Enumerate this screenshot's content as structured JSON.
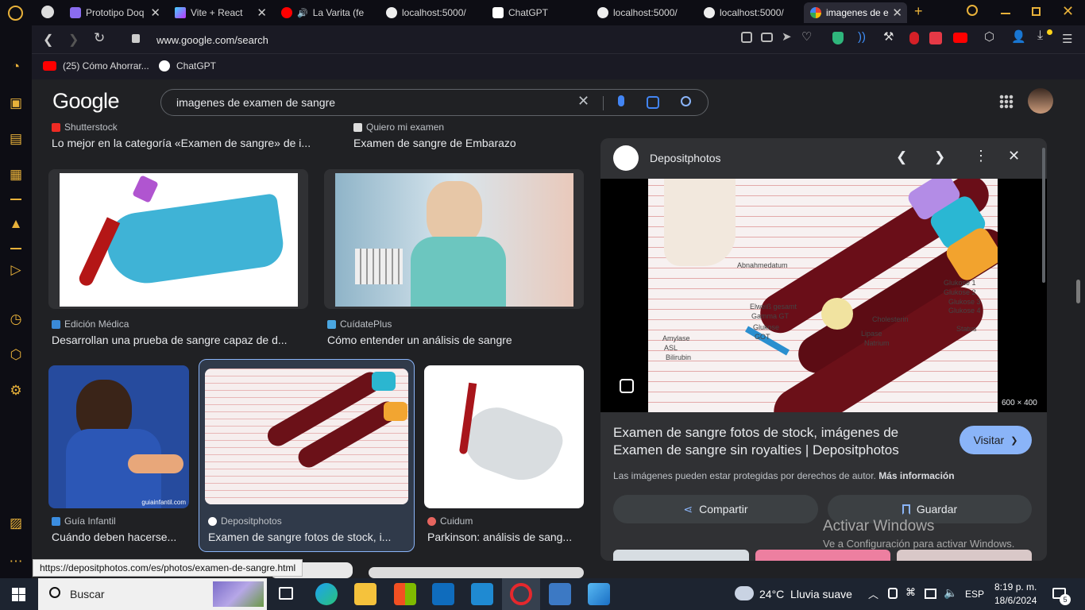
{
  "browser": {
    "tabs": [
      {
        "label": "Prototipo Doq",
        "active": false
      },
      {
        "label": "Vite + React",
        "active": false
      },
      {
        "label": "La Varita (fe",
        "active": false
      },
      {
        "label": "localhost:5000/",
        "active": false
      },
      {
        "label": "ChatGPT",
        "active": false
      },
      {
        "label": "localhost:5000/",
        "active": false
      },
      {
        "label": "localhost:5000/",
        "active": false
      },
      {
        "label": "imagenes de e",
        "active": true
      }
    ],
    "address": "www.google.com/search",
    "bookmarks": [
      "(25) Cómo Ahorrar...",
      "ChatGPT"
    ]
  },
  "google": {
    "logo": "Google",
    "query": "imagenes de examen de sangre"
  },
  "results": {
    "row0": [
      {
        "source": "Shutterstock",
        "title": "Lo mejor en la categoría «Examen de sangre» de i..."
      },
      {
        "source": "Quiero mi examen",
        "title": "Examen de sangre de Embarazo"
      }
    ],
    "row1": [
      {
        "source": "Edición Médica",
        "title": "Desarrollan una prueba de sangre capaz de d..."
      },
      {
        "source": "CuídatePlus",
        "title": "Cómo entender un análisis de sangre"
      }
    ],
    "row2": [
      {
        "source": "Guía Infantil",
        "title": "Cuándo deben hacerse..."
      },
      {
        "source": "Depositphotos",
        "title": "Examen de sangre fotos de stock, i..."
      },
      {
        "source": "Cuidum",
        "title": "Parkinson: análisis de sang..."
      }
    ],
    "watermark": "guiainfantil.com"
  },
  "panel": {
    "source": "Depositphotos",
    "dimensions": "600 × 400",
    "title": "Examen de sangre fotos de stock, imágenes de Examen de sangre sin royalties | Depositphotos",
    "visit_label": "Visitar",
    "copyright_note": "Las imágenes pueden estar protegidas por derechos de autor.",
    "more_info": "Más información",
    "share_label": "Compartir",
    "save_label": "Guardar",
    "tube_labels": [
      "Glukose 1",
      "Glukose 2",
      "Glukose 3",
      "Glukose 4",
      "Cholesterin",
      "Lipase",
      "Natrium",
      "Status",
      "Gamma GT",
      "Glukose",
      "GOT",
      "Amylase",
      "ASL",
      "Bilirubin",
      "Abnahmedatum",
      "Elweiß gesamt"
    ]
  },
  "activation": {
    "line1": "Activar Windows",
    "line2": "Ve a Configuración para activar Windows."
  },
  "status_url": "https://depositphotos.com/es/photos/examen-de-sangre.html",
  "taskbar": {
    "search_placeholder": "Buscar",
    "weather": "24°C  Lluvia suave",
    "language": "ESP",
    "time": "8:19 p. m.",
    "date": "18/6/2024",
    "notifications": "5"
  },
  "colors": {
    "accent_blue": "#8ab4f8",
    "opera_red": "#e5282d"
  }
}
